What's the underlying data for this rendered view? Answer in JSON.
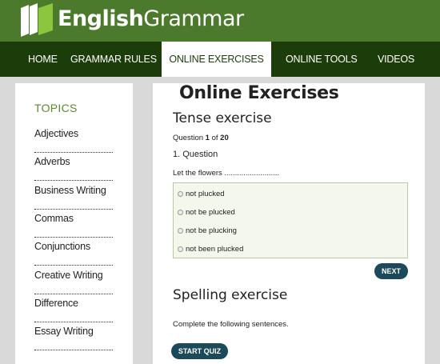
{
  "header": {
    "brand_bold": "English",
    "brand_light": "Grammar"
  },
  "nav": {
    "items": [
      {
        "label": "HOME"
      },
      {
        "label": "GRAMMAR RULES"
      },
      {
        "label": "ONLINE EXERCISES",
        "active": true
      },
      {
        "label": "ONLINE TOOLS"
      },
      {
        "label": "VIDEOS"
      }
    ]
  },
  "sidebar": {
    "heading": "TOPICS",
    "items": [
      {
        "label": "Adjectives"
      },
      {
        "label": "Adverbs"
      },
      {
        "label": "Business Writing"
      },
      {
        "label": "Commas"
      },
      {
        "label": "Conjunctions"
      },
      {
        "label": "Creative Writing"
      },
      {
        "label": "Difference"
      },
      {
        "label": "Essay Writing"
      }
    ]
  },
  "main": {
    "title": "Online Exercises",
    "tense": {
      "title": "Tense exercise",
      "progress_prefix": "Question ",
      "current": "1",
      "of_text": " of ",
      "total": "20",
      "question_label": "1. Question",
      "prompt": "Let the flowers ..........................",
      "options": [
        {
          "label": "not plucked"
        },
        {
          "label": "not be plucked"
        },
        {
          "label": "not be plucking"
        },
        {
          "label": "not been plucked"
        }
      ],
      "next_label": "NEXT"
    },
    "spelling": {
      "title": "Spelling exercise",
      "instruction": "Complete the following sentences.",
      "start_label": "START QUIZ"
    }
  },
  "colors": {
    "header_green": "#4c7a2c",
    "nav_dark": "#1c3d0a",
    "button": "#1c4a5a",
    "topics_green": "#5b8a2f"
  }
}
